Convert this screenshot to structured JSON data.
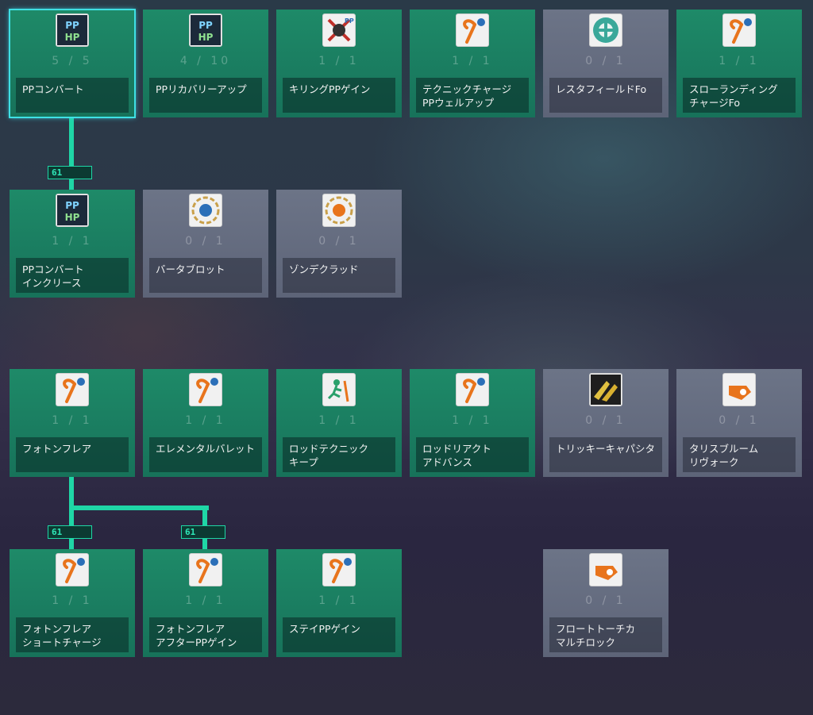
{
  "skills": [
    {
      "id": "r1c1",
      "name": "PPコンバート",
      "count": "5 / 5",
      "icon": "pp-convert-icon",
      "locked": false,
      "selected": true
    },
    {
      "id": "r1c2",
      "name": "PPリカバリーアップ",
      "count": "4 / 10",
      "icon": "pp-recovery-up-icon",
      "locked": false
    },
    {
      "id": "r1c3",
      "name": "キリングPPゲイン",
      "count": "1 / 1",
      "icon": "killing-pp-gain-icon",
      "locked": false
    },
    {
      "id": "r1c4",
      "name": "テクニックチャージ\nPPウェルアップ",
      "count": "1 / 1",
      "icon": "technique-charge-pp-icon",
      "locked": false
    },
    {
      "id": "r1c5",
      "name": "レスタフィールドFo",
      "count": "0 / 1",
      "icon": "resta-field-icon",
      "locked": true
    },
    {
      "id": "r1c6",
      "name": "スローランディング\nチャージFo",
      "count": "1 / 1",
      "icon": "slow-landing-charge-icon",
      "locked": false
    },
    {
      "id": "r2c1",
      "name": "PPコンバート\nインクリース",
      "count": "1 / 1",
      "icon": "pp-convert-increase-icon",
      "locked": false
    },
    {
      "id": "r2c2",
      "name": "バータブロット",
      "count": "0 / 1",
      "icon": "barta-blot-icon",
      "locked": true
    },
    {
      "id": "r2c3",
      "name": "ゾンデクラッド",
      "count": "0 / 1",
      "icon": "zonde-clad-icon",
      "locked": true
    },
    {
      "id": "r3c1",
      "name": "フォトンフレア",
      "count": "1 / 1",
      "icon": "photon-flare-icon",
      "locked": false
    },
    {
      "id": "r3c2",
      "name": "エレメンタルバレット",
      "count": "1 / 1",
      "icon": "elemental-bullet-icon",
      "locked": false
    },
    {
      "id": "r3c3",
      "name": "ロッドテクニック\nキープ",
      "count": "1 / 1",
      "icon": "rod-technique-keep-icon",
      "locked": false
    },
    {
      "id": "r3c4",
      "name": "ロッドリアクト\nアドバンス",
      "count": "1 / 1",
      "icon": "rod-react-advance-icon",
      "locked": false
    },
    {
      "id": "r3c5",
      "name": "トリッキーキャパシタ",
      "count": "0 / 1",
      "icon": "tricky-capacitor-icon",
      "locked": true
    },
    {
      "id": "r3c6",
      "name": "タリスブルーム\nリヴォーク",
      "count": "0 / 1",
      "icon": "talis-bloom-revoke-icon",
      "locked": true
    },
    {
      "id": "r4c1",
      "name": "フォトンフレア\nショートチャージ",
      "count": "1 / 1",
      "icon": "photon-flare-short-charge-icon",
      "locked": false
    },
    {
      "id": "r4c2",
      "name": "フォトンフレア\nアフターPPゲイン",
      "count": "1 / 1",
      "icon": "photon-flare-after-pp-icon",
      "locked": false
    },
    {
      "id": "r4c3",
      "name": "ステイPPゲイン",
      "count": "1 / 1",
      "icon": "stay-pp-gain-icon",
      "locked": false
    },
    {
      "id": "r4c5",
      "name": "フロートトーチカ\nマルチロック",
      "count": "0 / 1",
      "icon": "float-torchka-multilock-icon",
      "locked": true
    }
  ],
  "requirements": [
    "61",
    "61",
    "61"
  ],
  "colors": {
    "unlocked": "#1e8a68",
    "locked": "#6c7487",
    "connector": "#1fd6a6",
    "selection": "#3fe0e4"
  }
}
